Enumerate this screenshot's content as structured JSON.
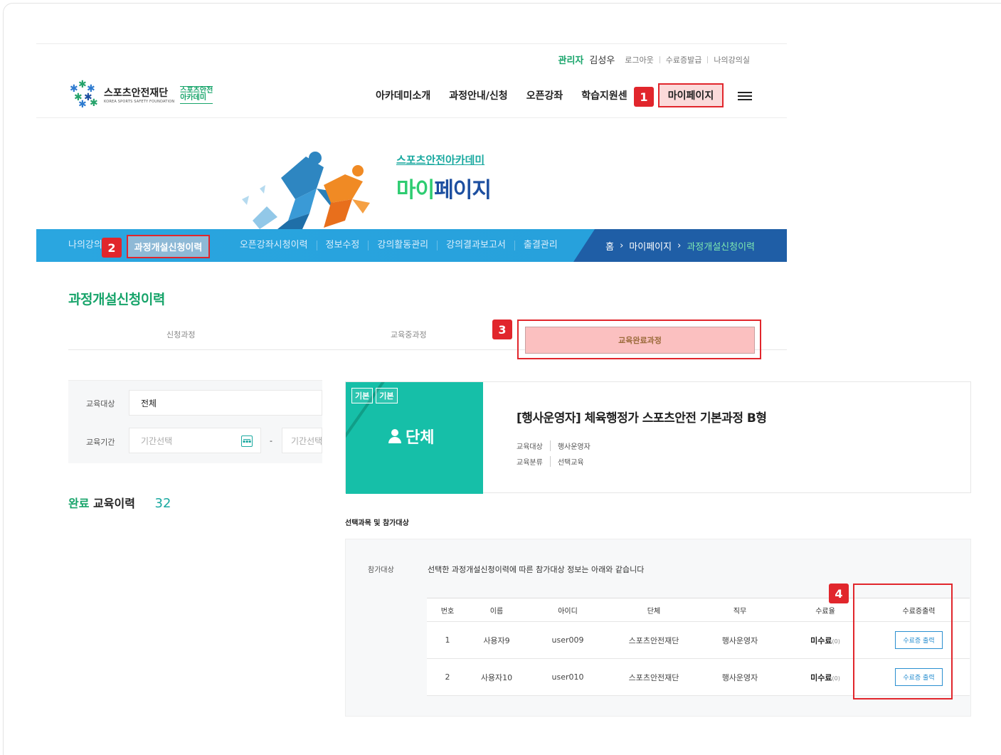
{
  "util_bar": {
    "role": "관리자",
    "user_name": "김성우",
    "links": [
      "로그아웃",
      "수료증발급",
      "나의강의실"
    ]
  },
  "logo": {
    "name_ko": "스포츠안전재단",
    "name_en": "KOREA SPORTS SAFETY FOUNDATION",
    "academy_line1": "스포츠안전",
    "academy_line2": "아카데미"
  },
  "gnb": {
    "items": [
      "아카데미소개",
      "과정안내/신청",
      "오픈강좌",
      "학습지원센"
    ],
    "mypage": "마이페이지"
  },
  "hero": {
    "subtitle": "스포츠안전아카데미",
    "title_part1": "마이",
    "title_part2": "페이지"
  },
  "lnb": {
    "items": [
      "나의강의",
      "과정개설신청이력",
      "오픈강좌시청이력",
      "정보수정",
      "강의활동관리",
      "강의결과보고서",
      "출결관리"
    ],
    "active": "과정개설신청이력",
    "breadcrumb": [
      "홈",
      "마이페이지",
      "과정개설신청이력"
    ]
  },
  "section_title": "과정개설신청이력",
  "tabs": [
    "신청과정",
    "교육중과정",
    "교육완료과정"
  ],
  "filter": {
    "target_label": "교육대상",
    "target_value": "전체",
    "period_label": "교육기간",
    "start_placeholder": "기간선택",
    "dash": "-",
    "end_placeholder": "기간선택"
  },
  "summary": {
    "prefix": "완료",
    "label": "교육이력",
    "count": "32"
  },
  "card": {
    "chips": [
      "기본",
      "기본"
    ],
    "group_label": "단체",
    "title": "[행사운영자] 체육행정가 스포츠안전 기본과정 B형",
    "meta": [
      {
        "key": "교육대상",
        "value": "행사운영자"
      },
      {
        "key": "교육분류",
        "value": "선택교육"
      }
    ]
  },
  "participants": {
    "section_label": "선택과목 및 참가대상",
    "label": "참가대상",
    "description": "선택한 과정개설신청이력에 따른 참가대상 정보는 아래와 같습니다",
    "headers": [
      "번호",
      "이름",
      "아이디",
      "단체",
      "직무",
      "수료율",
      "수료증출력"
    ],
    "rows": [
      {
        "no": "1",
        "name": "사용자9",
        "id": "user009",
        "org": "스포츠안전재단",
        "role": "행사운영자",
        "status": "미수료",
        "rate": "(0)",
        "action": "수료증 출력"
      },
      {
        "no": "2",
        "name": "사용자10",
        "id": "user010",
        "org": "스포츠안전재단",
        "role": "행사운영자",
        "status": "미수료",
        "rate": "(0)",
        "action": "수료증 출력"
      }
    ]
  },
  "annotations": [
    "1",
    "2",
    "3",
    "4"
  ],
  "colors": {
    "accent_green": "#17a46a",
    "teal": "#16bfa8",
    "lnb_blue": "#2aa6e0",
    "highlight_red": "#e1262c"
  }
}
